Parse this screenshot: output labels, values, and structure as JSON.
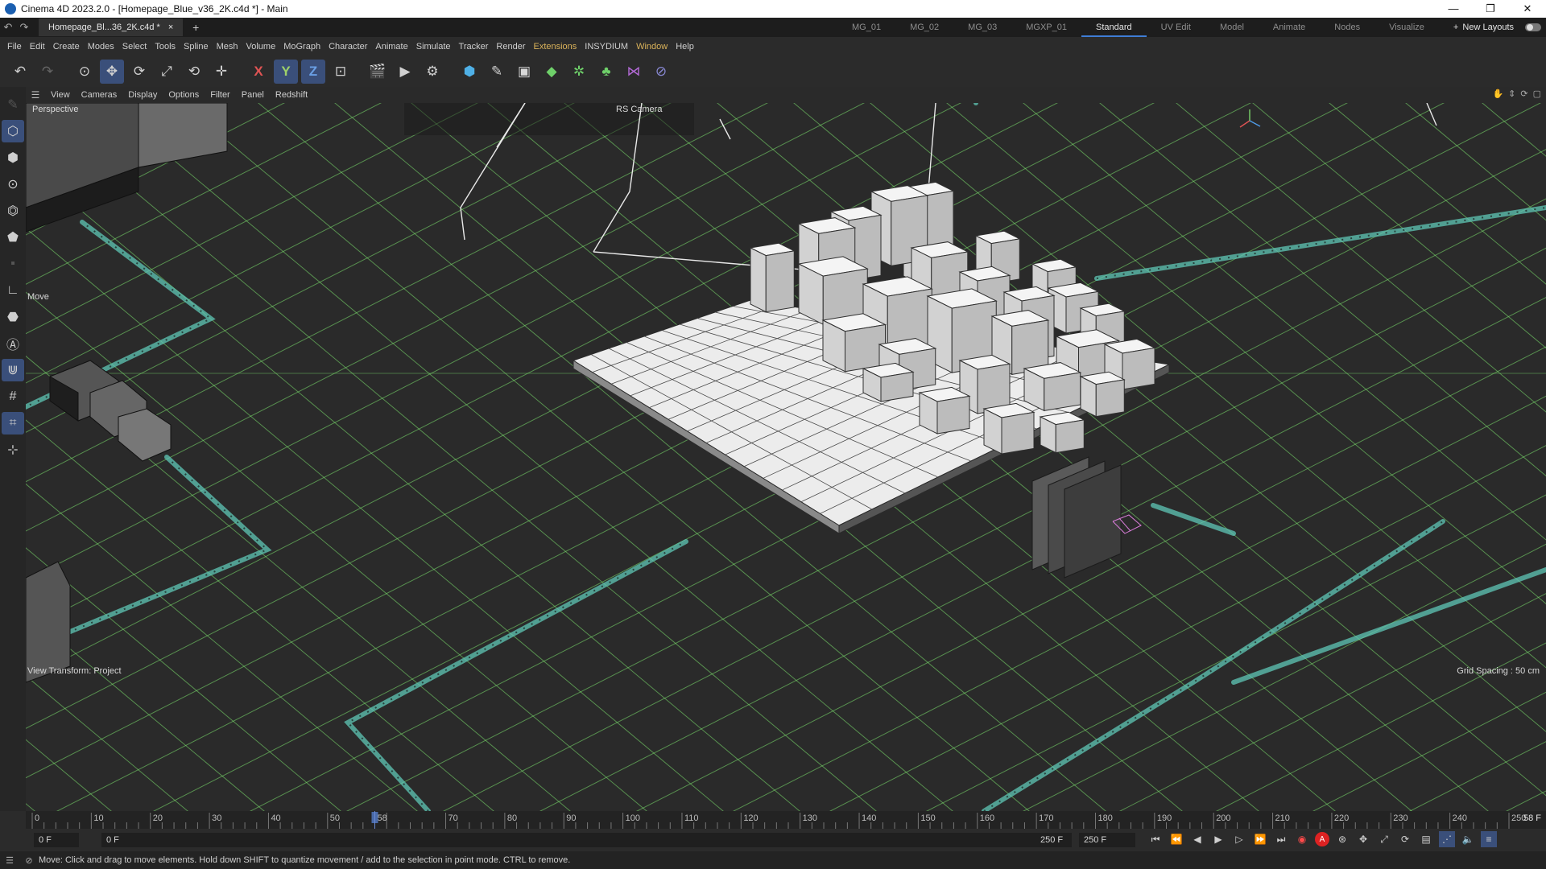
{
  "window": {
    "title": "Cinema 4D 2023.2.0 - [Homepage_Blue_v36_2K.c4d *] - Main",
    "minimize": "—",
    "restore": "❐",
    "close": "✕"
  },
  "tabs": {
    "document": "Homepage_Bl...36_2K.c4d *",
    "close": "×",
    "add": "+",
    "layouts": [
      "MG_01",
      "MG_02",
      "MG_03",
      "MGXP_01",
      "Standard",
      "UV Edit",
      "Model",
      "Animate",
      "Nodes",
      "Visualize"
    ],
    "active_layout": "Standard",
    "add_layout": "+",
    "new_layouts": "New Layouts"
  },
  "menu": [
    "File",
    "Edit",
    "Create",
    "Modes",
    "Select",
    "Tools",
    "Spline",
    "Mesh",
    "Volume",
    "MoGraph",
    "Character",
    "Animate",
    "Simulate",
    "Tracker",
    "Render",
    "Extensions",
    "INSYDIUM",
    "Window",
    "Help"
  ],
  "menu_highlight": [
    "Extensions",
    "Window"
  ],
  "toolbar": {
    "x_axis": "X",
    "y_axis": "Y",
    "z_axis": "Z"
  },
  "viewport": {
    "menu": [
      "View",
      "Cameras",
      "Display",
      "Options",
      "Filter",
      "Panel",
      "Redshift"
    ],
    "projection": "Perspective",
    "camera": "RS Camera",
    "tool_label": "Move",
    "view_transform": "View Transform: Project",
    "grid_spacing": "Grid Spacing : 50 cm",
    "grid_color": "#7de36e",
    "background": "#2a2a2a",
    "accent_cyan": "#5fc7b6"
  },
  "timeline": {
    "ticks": [
      "0",
      "10",
      "20",
      "30",
      "40",
      "50",
      "58",
      "70",
      "80",
      "90",
      "100",
      "110",
      "120",
      "130",
      "140",
      "150",
      "160",
      "170",
      "180",
      "190",
      "200",
      "210",
      "220",
      "230",
      "240",
      "250"
    ],
    "current_frame": "58 F",
    "playhead": 58,
    "end": 250
  },
  "transport": {
    "start_field": "0 F",
    "current_field": "0 F",
    "end_field_a": "250 F",
    "end_field_b": "250 F",
    "auto_key": "A"
  },
  "status": {
    "message": "Move: Click and drag to move elements. Hold down SHIFT to quantize movement / add to the selection in point mode. CTRL to remove."
  }
}
